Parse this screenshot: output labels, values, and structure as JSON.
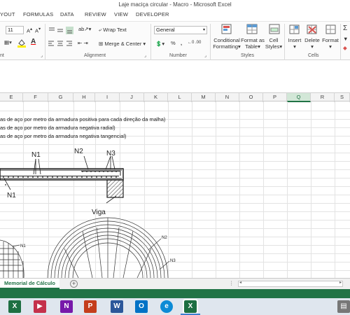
{
  "window": {
    "title": "Laje maciça circular - Macro - Microsoft Excel"
  },
  "tabs": [
    "YOUT",
    "FORMULAS",
    "DATA",
    "REVIEW",
    "VIEW",
    "DEVELOPER"
  ],
  "ribbon": {
    "font_size": "11",
    "wrap_text": "Wrap Text",
    "merge_center": "Merge & Center",
    "number_format": "General",
    "conditional_formatting": [
      "Conditional",
      "Formatting"
    ],
    "format_as_table": [
      "Format as",
      "Table"
    ],
    "cell_styles": [
      "Cell",
      "Styles"
    ],
    "insert": "Insert",
    "delete": "Delete",
    "format": "Format",
    "groups": {
      "font": "nt",
      "alignment": "Alignment",
      "number": "Number",
      "styles": "Styles",
      "cells": "Cells"
    },
    "percent": "%",
    "comma": ","
  },
  "columns": [
    "E",
    "F",
    "G",
    "H",
    "I",
    "J",
    "K",
    "L",
    "M",
    "N",
    "O",
    "P",
    "Q",
    "R",
    "S"
  ],
  "selected_column": "Q",
  "notes": [
    "as de aço por metro da armadura positiva para cada direção da malha)",
    "as de aço por metro da armadura negativa radial)",
    "as de aço por metro da armadura negativa tangencial)"
  ],
  "drawing": {
    "labels": {
      "n1": "N1",
      "n2": "N2",
      "n3": "N3",
      "viga": "Viga",
      "n1_left": "N1",
      "n1_circle": "N1",
      "n2_circle": "N2",
      "n3_circle": "N3"
    }
  },
  "sheet": {
    "tab": "Memorial de Cálculo",
    "add": "+"
  },
  "taskbar": {
    "apps": [
      "Excel",
      "Stream",
      "OneNote",
      "PowerPoint",
      "Word",
      "Outlook",
      "Edge",
      "Excel"
    ]
  }
}
